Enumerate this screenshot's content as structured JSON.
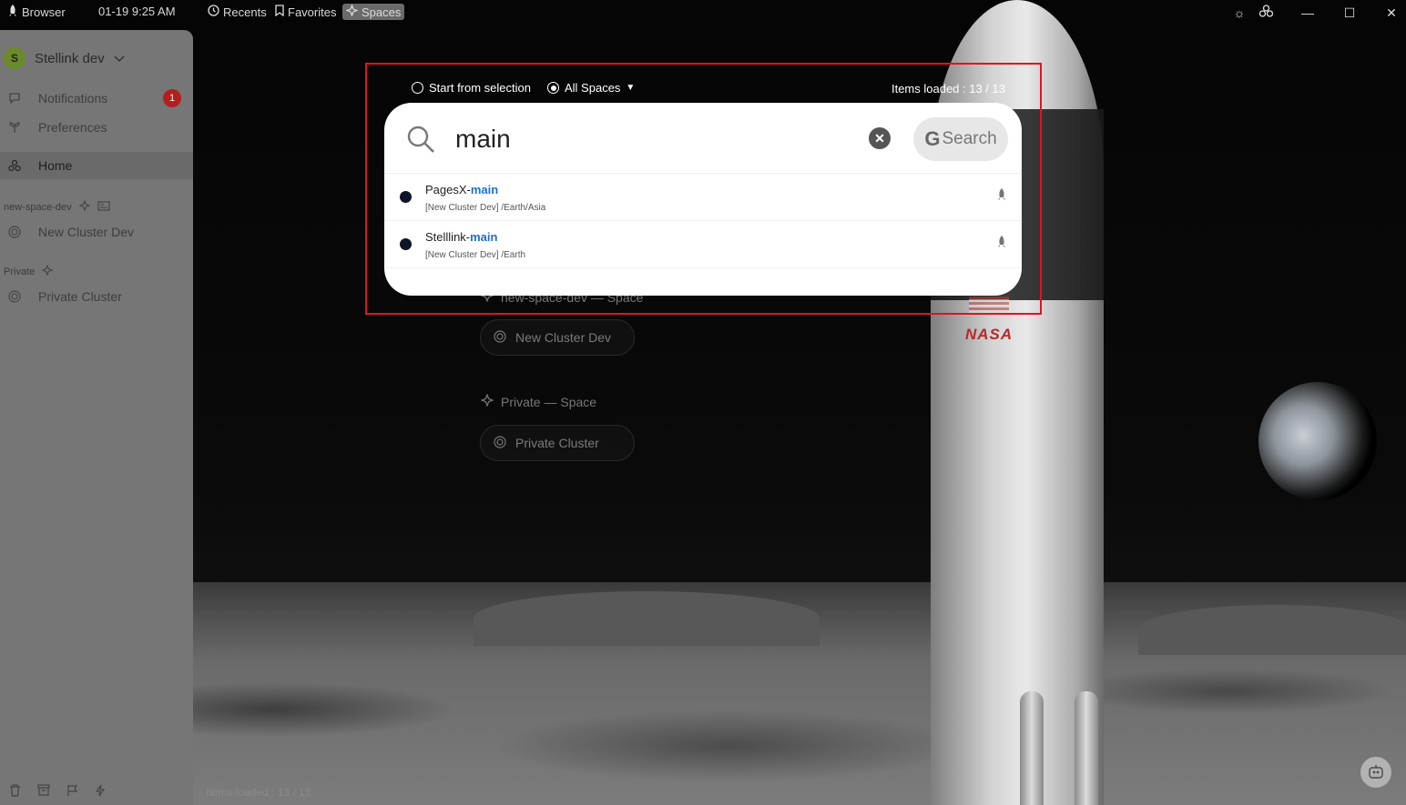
{
  "titlebar": {
    "app_name": "Browser",
    "datetime": "01-19 9:25 AM",
    "recents": "Recents",
    "favorites": "Favorites",
    "spaces": "Spaces"
  },
  "sidebar": {
    "workspace_initial": "S",
    "workspace_name": "Stellink dev",
    "notifications_label": "Notifications",
    "notifications_count": "1",
    "preferences_label": "Preferences",
    "home_label": "Home",
    "section_new_space": "new-space-dev",
    "new_cluster": "New Cluster Dev",
    "section_private": "Private",
    "private_cluster": "Private Cluster"
  },
  "home": {
    "section_new_space_title": "new-space-dev — Space",
    "new_cluster_card": "New Cluster Dev",
    "section_private_title": "Private — Space",
    "private_cluster_card": "Private Cluster",
    "items_loaded": "Items loaded : 13 / 13"
  },
  "search": {
    "option_start": "Start from selection",
    "option_all": "All Spaces",
    "items_loaded": "Items loaded : 13 / 13",
    "query": "main",
    "google_letter": "G",
    "google_label": "Search",
    "results": [
      {
        "prefix": "PagesX-",
        "match": "main",
        "path": "[New Cluster Dev] /Earth/Asia"
      },
      {
        "prefix": "Stelllink-",
        "match": "main",
        "path": "[New Cluster Dev] /Earth"
      }
    ]
  },
  "colors": {
    "highlight_border": "#e0141e",
    "match_text": "#1d6fd0",
    "badge": "#b21f1f"
  }
}
